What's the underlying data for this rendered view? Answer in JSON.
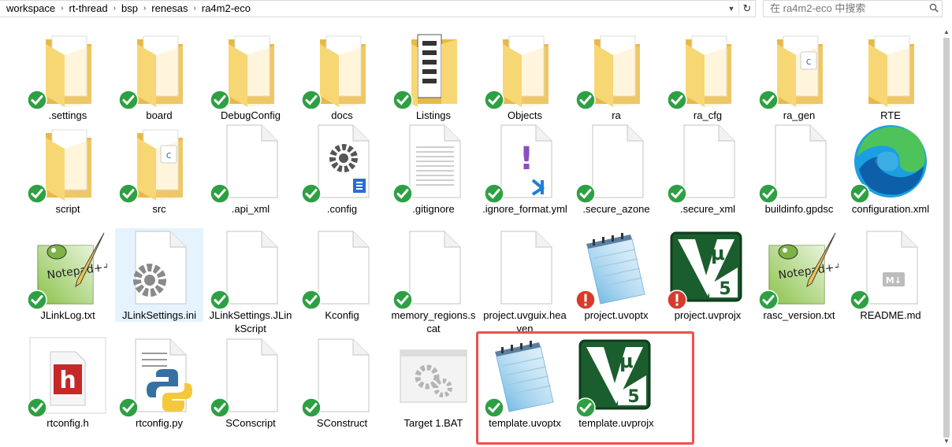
{
  "address_bar": {
    "breadcrumbs": [
      "workspace",
      "rt-thread",
      "bsp",
      "renesas",
      "ra4m2-eco"
    ]
  },
  "search": {
    "placeholder": "在 ra4m2-eco 中搜索"
  },
  "colors": {
    "sync_ok": "#2ea043",
    "sync_error": "#d83b2b",
    "folder": "#f7d774",
    "highlight": "#f05050",
    "selection": "#e5f3ff"
  },
  "files": [
    {
      "name": ".settings",
      "icon": "folder-icon",
      "status": "ok"
    },
    {
      "name": "board",
      "icon": "folder-icon",
      "status": "ok"
    },
    {
      "name": "DebugConfig",
      "icon": "folder-icon",
      "status": "ok"
    },
    {
      "name": "docs",
      "icon": "folder-icon",
      "status": "ok"
    },
    {
      "name": "Listings",
      "icon": "folder-documents-icon",
      "status": "ok"
    },
    {
      "name": "Objects",
      "icon": "folder-icon",
      "status": "ok"
    },
    {
      "name": "ra",
      "icon": "folder-icon",
      "status": "ok"
    },
    {
      "name": "ra_cfg",
      "icon": "folder-icon",
      "status": "ok"
    },
    {
      "name": "ra_gen",
      "icon": "folder-c-icon",
      "status": "ok"
    },
    {
      "name": "RTE",
      "icon": "folder-icon",
      "status": "none"
    },
    {
      "name": "script",
      "icon": "folder-icon",
      "status": "ok"
    },
    {
      "name": "src",
      "icon": "folder-c-icon",
      "status": "ok"
    },
    {
      "name": ".api_xml",
      "icon": "blank-file-icon",
      "status": "ok"
    },
    {
      "name": ".config",
      "icon": "config-file-icon",
      "status": "ok"
    },
    {
      "name": ".gitignore",
      "icon": "text-file-icon",
      "status": "ok"
    },
    {
      "name": ".ignore_format.yml",
      "icon": "yml-file-icon",
      "status": "ok"
    },
    {
      "name": ".secure_azone",
      "icon": "blank-file-icon",
      "status": "ok"
    },
    {
      "name": ".secure_xml",
      "icon": "blank-file-icon",
      "status": "ok"
    },
    {
      "name": "buildinfo.gpdsc",
      "icon": "blank-file-icon",
      "status": "ok"
    },
    {
      "name": "configuration.xml",
      "icon": "edge-icon",
      "status": "ok"
    },
    {
      "name": "JLinkLog.txt",
      "icon": "notepad-plus-icon",
      "status": "ok"
    },
    {
      "name": "JLinkSettings.ini",
      "icon": "settings-file-icon",
      "status": "none"
    },
    {
      "name": "JLinkSettings.JLinkScript",
      "icon": "blank-file-icon",
      "status": "ok"
    },
    {
      "name": "Kconfig",
      "icon": "blank-file-icon",
      "status": "ok"
    },
    {
      "name": "memory_regions.scat",
      "icon": "blank-file-icon",
      "status": "ok"
    },
    {
      "name": "project.uvguix.heaven",
      "icon": "blank-file-icon",
      "status": "none"
    },
    {
      "name": "project.uvoptx",
      "icon": "notepad-icon",
      "status": "error"
    },
    {
      "name": "project.uvprojx",
      "icon": "keil-uvision-icon",
      "status": "error"
    },
    {
      "name": "rasc_version.txt",
      "icon": "notepad-plus-icon",
      "status": "ok"
    },
    {
      "name": "README.md",
      "icon": "markdown-file-icon",
      "status": "ok"
    },
    {
      "name": "rtconfig.h",
      "icon": "h-file-icon",
      "status": "ok"
    },
    {
      "name": "rtconfig.py",
      "icon": "python-file-icon",
      "status": "ok"
    },
    {
      "name": "SConscript",
      "icon": "blank-file-icon",
      "status": "ok"
    },
    {
      "name": "SConstruct",
      "icon": "blank-file-icon",
      "status": "ok"
    },
    {
      "name": "Target 1.BAT",
      "icon": "batch-file-icon",
      "status": "none"
    },
    {
      "name": "template.uvoptx",
      "icon": "notepad-icon",
      "status": "ok"
    },
    {
      "name": "template.uvprojx",
      "icon": "keil-uvision-icon",
      "status": "ok"
    }
  ]
}
